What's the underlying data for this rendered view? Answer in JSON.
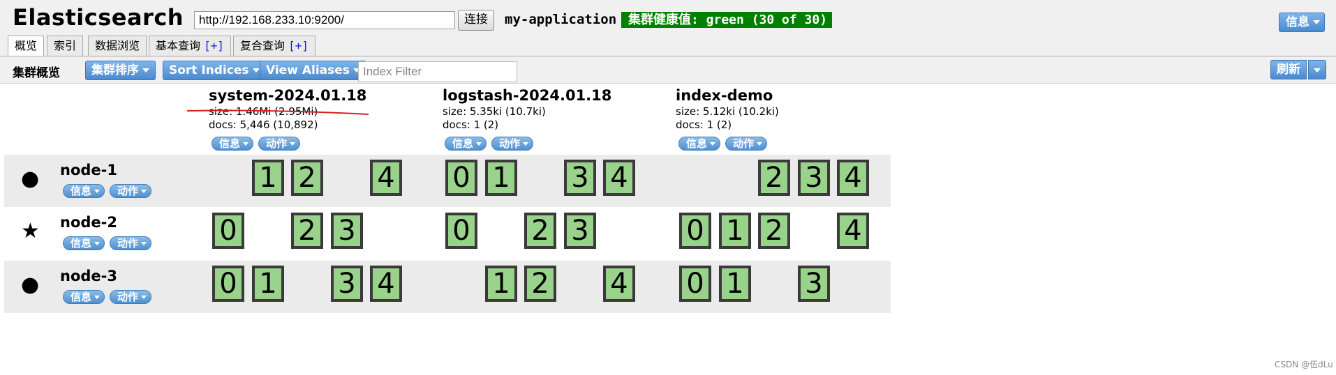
{
  "header": {
    "app_title": "Elasticsearch",
    "url_value": "http://192.168.233.10:9200/",
    "connect_label": "连接",
    "cluster_name": "my-application",
    "health_text": "集群健康值: green (30 of 30)",
    "health_color": "#008000",
    "info_label": "信息"
  },
  "tabs": [
    {
      "label": "概览",
      "active": true
    },
    {
      "label": "索引"
    },
    {
      "label": "数据浏览"
    },
    {
      "label": "基本查询",
      "plus": "[+]"
    },
    {
      "label": "复合查询",
      "plus": "[+]"
    }
  ],
  "toolbar": {
    "title": "集群概览",
    "sort_cluster_label": "集群排序",
    "sort_indices_label": "Sort Indices",
    "view_aliases_label": "View Aliases",
    "filter_placeholder": "Index Filter",
    "refresh_label": "刷新"
  },
  "indices": [
    {
      "name": "system-2024.01.18",
      "size": "size: 1.46Mi (2.95Mi)",
      "docs": "docs: 5,446 (10,892)",
      "info": "信息",
      "action": "动作"
    },
    {
      "name": "logstash-2024.01.18",
      "size": "size: 5.35ki (10.7ki)",
      "docs": "docs: 1 (2)",
      "info": "信息",
      "action": "动作"
    },
    {
      "name": "index-demo",
      "size": "size: 5.12ki (10.2ki)",
      "docs": "docs: 1 (2)",
      "info": "信息",
      "action": "动作"
    }
  ],
  "nodes": [
    {
      "name": "node-1",
      "icon": "circle-icon",
      "symbol": "●",
      "info": "信息",
      "action": "动作",
      "shards": {
        "system-2024.01.18": [
          "1",
          "2",
          "4"
        ],
        "logstash-2024.01.18": [
          "0",
          "1",
          "3",
          "4"
        ],
        "index-demo": [
          "2",
          "3",
          "4"
        ]
      }
    },
    {
      "name": "node-2",
      "icon": "star-icon",
      "symbol": "★",
      "info": "信息",
      "action": "动作",
      "shards": {
        "system-2024.01.18": [
          "0",
          "2",
          "3"
        ],
        "logstash-2024.01.18": [
          "0",
          "2",
          "3"
        ],
        "index-demo": [
          "0",
          "1",
          "2",
          "4"
        ]
      }
    },
    {
      "name": "node-3",
      "icon": "circle-icon",
      "symbol": "●",
      "info": "信息",
      "action": "动作",
      "shards": {
        "system-2024.01.18": [
          "0",
          "1",
          "3",
          "4"
        ],
        "logstash-2024.01.18": [
          "1",
          "2",
          "4"
        ],
        "index-demo": [
          "0",
          "1",
          "3"
        ]
      }
    }
  ],
  "footer": {
    "watermark": "CSDN @伍dLu"
  },
  "colors": {
    "shard_fill": "#99d28b",
    "button_blue": "#5a98d8",
    "annotation_red": "#d42020"
  }
}
